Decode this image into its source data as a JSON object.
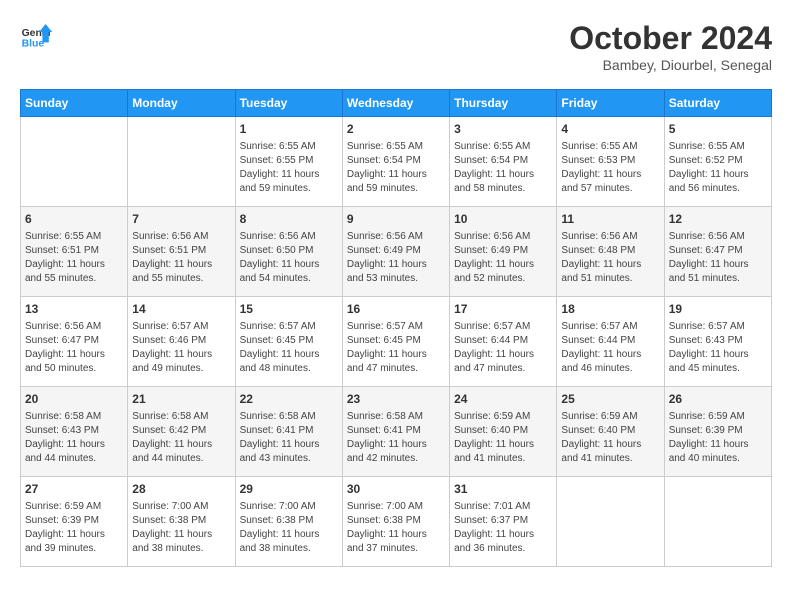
{
  "logo": {
    "line1": "General",
    "line2": "Blue"
  },
  "title": "October 2024",
  "location": "Bambey, Diourbel, Senegal",
  "weekdays": [
    "Sunday",
    "Monday",
    "Tuesday",
    "Wednesday",
    "Thursday",
    "Friday",
    "Saturday"
  ],
  "weeks": [
    [
      {
        "day": "",
        "info": ""
      },
      {
        "day": "",
        "info": ""
      },
      {
        "day": "1",
        "info": "Sunrise: 6:55 AM\nSunset: 6:55 PM\nDaylight: 11 hours\nand 59 minutes."
      },
      {
        "day": "2",
        "info": "Sunrise: 6:55 AM\nSunset: 6:54 PM\nDaylight: 11 hours\nand 59 minutes."
      },
      {
        "day": "3",
        "info": "Sunrise: 6:55 AM\nSunset: 6:54 PM\nDaylight: 11 hours\nand 58 minutes."
      },
      {
        "day": "4",
        "info": "Sunrise: 6:55 AM\nSunset: 6:53 PM\nDaylight: 11 hours\nand 57 minutes."
      },
      {
        "day": "5",
        "info": "Sunrise: 6:55 AM\nSunset: 6:52 PM\nDaylight: 11 hours\nand 56 minutes."
      }
    ],
    [
      {
        "day": "6",
        "info": "Sunrise: 6:55 AM\nSunset: 6:51 PM\nDaylight: 11 hours\nand 55 minutes."
      },
      {
        "day": "7",
        "info": "Sunrise: 6:56 AM\nSunset: 6:51 PM\nDaylight: 11 hours\nand 55 minutes."
      },
      {
        "day": "8",
        "info": "Sunrise: 6:56 AM\nSunset: 6:50 PM\nDaylight: 11 hours\nand 54 minutes."
      },
      {
        "day": "9",
        "info": "Sunrise: 6:56 AM\nSunset: 6:49 PM\nDaylight: 11 hours\nand 53 minutes."
      },
      {
        "day": "10",
        "info": "Sunrise: 6:56 AM\nSunset: 6:49 PM\nDaylight: 11 hours\nand 52 minutes."
      },
      {
        "day": "11",
        "info": "Sunrise: 6:56 AM\nSunset: 6:48 PM\nDaylight: 11 hours\nand 51 minutes."
      },
      {
        "day": "12",
        "info": "Sunrise: 6:56 AM\nSunset: 6:47 PM\nDaylight: 11 hours\nand 51 minutes."
      }
    ],
    [
      {
        "day": "13",
        "info": "Sunrise: 6:56 AM\nSunset: 6:47 PM\nDaylight: 11 hours\nand 50 minutes."
      },
      {
        "day": "14",
        "info": "Sunrise: 6:57 AM\nSunset: 6:46 PM\nDaylight: 11 hours\nand 49 minutes."
      },
      {
        "day": "15",
        "info": "Sunrise: 6:57 AM\nSunset: 6:45 PM\nDaylight: 11 hours\nand 48 minutes."
      },
      {
        "day": "16",
        "info": "Sunrise: 6:57 AM\nSunset: 6:45 PM\nDaylight: 11 hours\nand 47 minutes."
      },
      {
        "day": "17",
        "info": "Sunrise: 6:57 AM\nSunset: 6:44 PM\nDaylight: 11 hours\nand 47 minutes."
      },
      {
        "day": "18",
        "info": "Sunrise: 6:57 AM\nSunset: 6:44 PM\nDaylight: 11 hours\nand 46 minutes."
      },
      {
        "day": "19",
        "info": "Sunrise: 6:57 AM\nSunset: 6:43 PM\nDaylight: 11 hours\nand 45 minutes."
      }
    ],
    [
      {
        "day": "20",
        "info": "Sunrise: 6:58 AM\nSunset: 6:43 PM\nDaylight: 11 hours\nand 44 minutes."
      },
      {
        "day": "21",
        "info": "Sunrise: 6:58 AM\nSunset: 6:42 PM\nDaylight: 11 hours\nand 44 minutes."
      },
      {
        "day": "22",
        "info": "Sunrise: 6:58 AM\nSunset: 6:41 PM\nDaylight: 11 hours\nand 43 minutes."
      },
      {
        "day": "23",
        "info": "Sunrise: 6:58 AM\nSunset: 6:41 PM\nDaylight: 11 hours\nand 42 minutes."
      },
      {
        "day": "24",
        "info": "Sunrise: 6:59 AM\nSunset: 6:40 PM\nDaylight: 11 hours\nand 41 minutes."
      },
      {
        "day": "25",
        "info": "Sunrise: 6:59 AM\nSunset: 6:40 PM\nDaylight: 11 hours\nand 41 minutes."
      },
      {
        "day": "26",
        "info": "Sunrise: 6:59 AM\nSunset: 6:39 PM\nDaylight: 11 hours\nand 40 minutes."
      }
    ],
    [
      {
        "day": "27",
        "info": "Sunrise: 6:59 AM\nSunset: 6:39 PM\nDaylight: 11 hours\nand 39 minutes."
      },
      {
        "day": "28",
        "info": "Sunrise: 7:00 AM\nSunset: 6:38 PM\nDaylight: 11 hours\nand 38 minutes."
      },
      {
        "day": "29",
        "info": "Sunrise: 7:00 AM\nSunset: 6:38 PM\nDaylight: 11 hours\nand 38 minutes."
      },
      {
        "day": "30",
        "info": "Sunrise: 7:00 AM\nSunset: 6:38 PM\nDaylight: 11 hours\nand 37 minutes."
      },
      {
        "day": "31",
        "info": "Sunrise: 7:01 AM\nSunset: 6:37 PM\nDaylight: 11 hours\nand 36 minutes."
      },
      {
        "day": "",
        "info": ""
      },
      {
        "day": "",
        "info": ""
      }
    ]
  ]
}
